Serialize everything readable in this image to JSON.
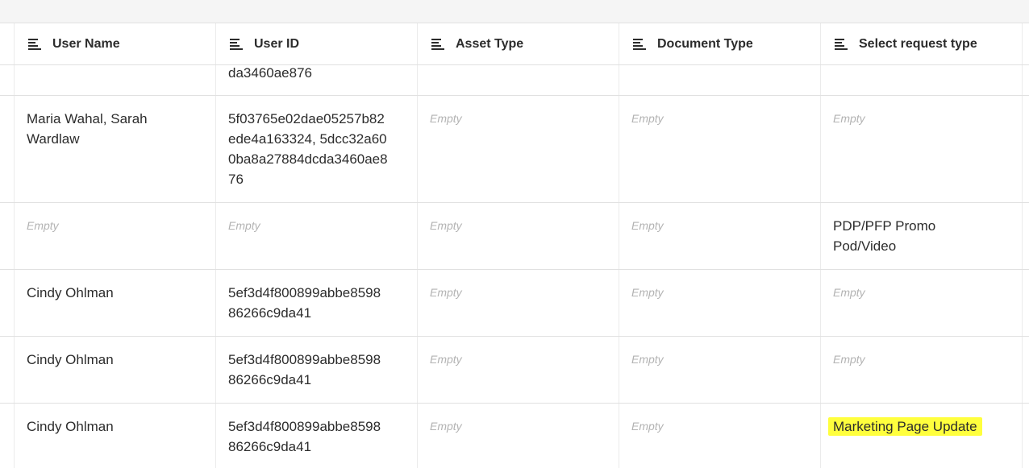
{
  "columns": [
    {
      "label": "User Name",
      "icon": "sort-lines-icon"
    },
    {
      "label": "User ID",
      "icon": "sort-lines-icon"
    },
    {
      "label": "Asset Type",
      "icon": "sort-lines-icon"
    },
    {
      "label": "Document Type",
      "icon": "sort-lines-icon"
    },
    {
      "label": "Select request type",
      "icon": "sort-lines-icon"
    }
  ],
  "rows": [
    {
      "user_name": "",
      "user_id": "da3460ae876",
      "asset_type": "",
      "document_type": "",
      "request_type": ""
    },
    {
      "user_name": "Maria Wahal, Sarah Wardlaw",
      "user_id": "5f03765e02dae05257b82ede4a163324, 5dcc32a600ba8a27884dcda3460ae876",
      "asset_type": "Empty",
      "document_type": "Empty",
      "request_type": "Empty"
    },
    {
      "user_name": "Empty",
      "user_id": "Empty",
      "asset_type": "Empty",
      "document_type": "Empty",
      "request_type": "PDP/PFP Promo Pod/Video"
    },
    {
      "user_name": "Cindy Ohlman",
      "user_id": "5ef3d4f800899abbe859886266c9da41",
      "asset_type": "Empty",
      "document_type": "Empty",
      "request_type": "Empty"
    },
    {
      "user_name": "Cindy Ohlman",
      "user_id": "5ef3d4f800899abbe859886266c9da41",
      "asset_type": "Empty",
      "document_type": "Empty",
      "request_type": "Empty"
    },
    {
      "user_name": "Cindy Ohlman",
      "user_id": "5ef3d4f800899abbe859886266c9da41",
      "asset_type": "Empty",
      "document_type": "Empty",
      "request_type": "Marketing Page Update"
    }
  ],
  "colors": {
    "highlight": "#ffff3d",
    "empty_text": "#b3b3b3",
    "text": "#2c2c2c",
    "border": "#e1e1e1"
  }
}
